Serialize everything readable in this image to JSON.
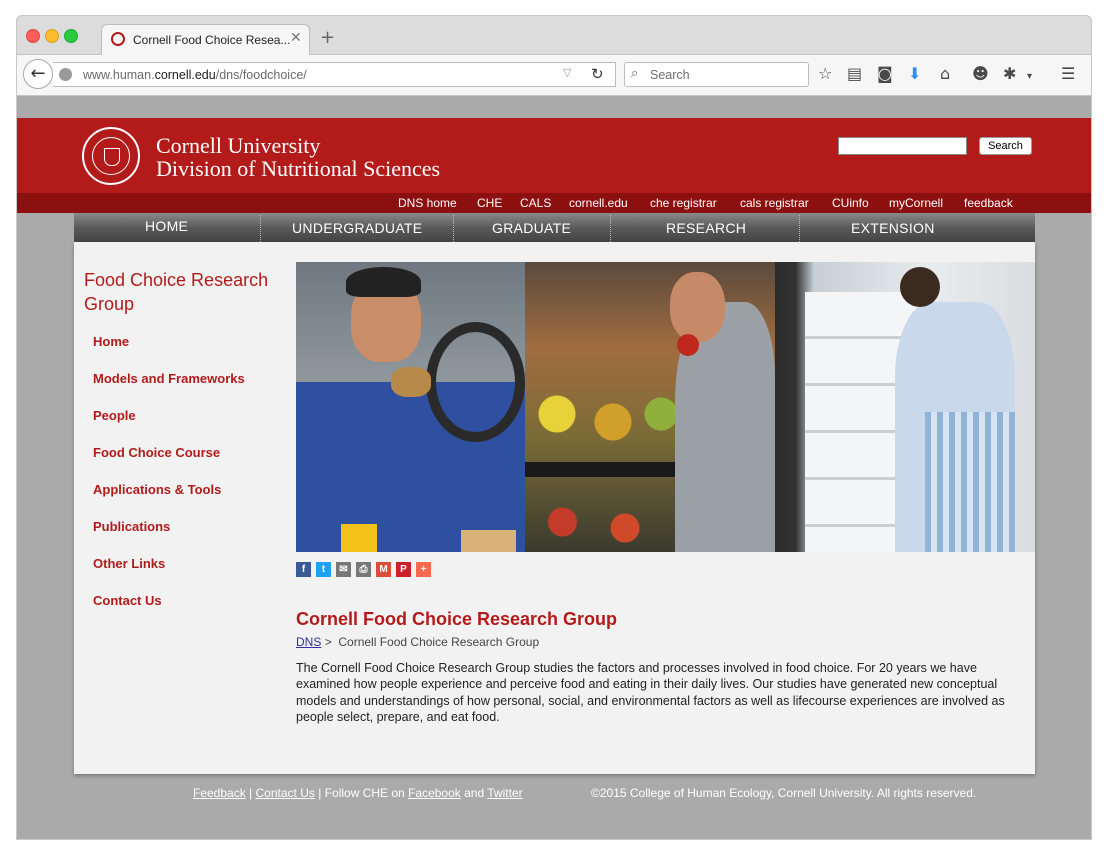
{
  "browser": {
    "tab_title": "Cornell Food Choice Resea...",
    "url_prefix": "www.human.",
    "url_domain": "cornell.edu",
    "url_path": "/dns/foodchoice/",
    "search_placeholder": "Search"
  },
  "header": {
    "university": "Cornell University",
    "division": "Division of Nutritional Sciences",
    "search_button": "Search"
  },
  "top_links": [
    "DNS home",
    "CHE",
    "CALS",
    "cornell.edu",
    "che registrar",
    "cals registrar",
    "CUinfo",
    "myCornell",
    "feedback"
  ],
  "main_nav": [
    "HOME",
    "UNDERGRADUATE",
    "GRADUATE",
    "RESEARCH",
    "EXTENSION"
  ],
  "sidebar": {
    "title": "Food Choice Research Group",
    "items": [
      "Home",
      "Models and Frameworks",
      "People",
      "Food Choice Course",
      "Applications & Tools",
      "Publications",
      "Other Links",
      "Contact Us"
    ]
  },
  "share": [
    "f",
    "t",
    "✉",
    "⎙",
    "M",
    "P",
    "+"
  ],
  "main": {
    "title": "Cornell Food Choice Research Group",
    "breadcrumb_link": "DNS",
    "breadcrumb_sep": ">",
    "breadcrumb_current": "Cornell Food Choice Research Group",
    "intro": "The Cornell Food Choice Research Group studies the factors and processes involved in food choice.  For 20 years we have examined how people experience and perceive food and eating in their daily lives.  Our studies have generated new conceptual models and understandings of how personal, social, and environmental factors as well as lifecourse experiences are involved as people select, prepare, and eat food."
  },
  "footer": {
    "feedback": "Feedback",
    "sep": "|",
    "contact": "Contact Us",
    "follow": "Follow CHE on",
    "facebook": "Facebook",
    "and": "and",
    "twitter": "Twitter",
    "copyright": "©2015 College of Human Ecology, Cornell University. All rights reserved."
  }
}
